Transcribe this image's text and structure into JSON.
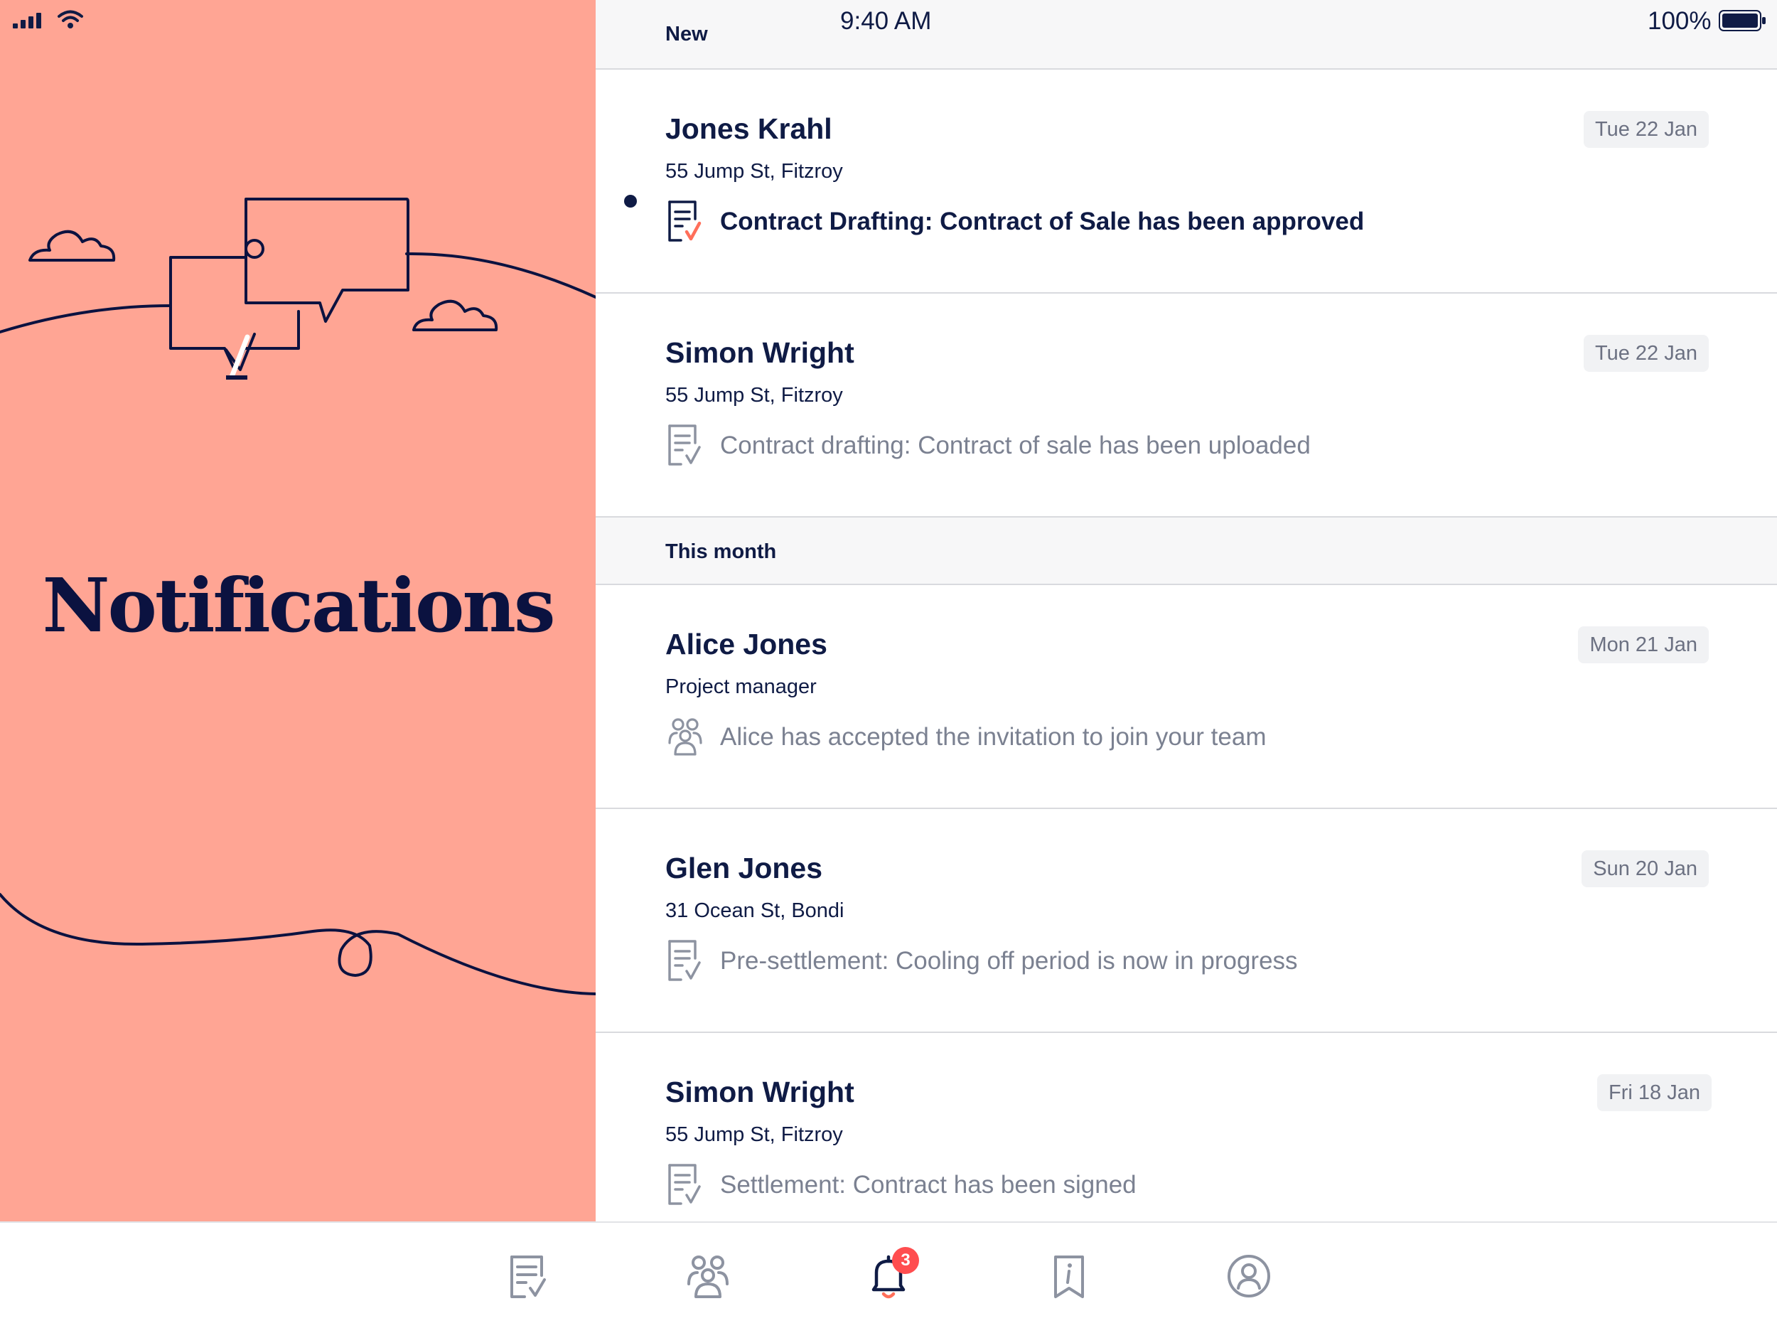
{
  "status_bar": {
    "time": "9:40 AM",
    "battery_percent": "100%",
    "icons": [
      "signal-icon",
      "wifi-icon",
      "battery-icon"
    ]
  },
  "left_panel": {
    "title": "Notifications",
    "background_color": "#ffa594"
  },
  "sections": [
    {
      "label": "New",
      "notifications": [
        {
          "name": "Jones Krahl",
          "subtitle": "55 Jump St, Fitzroy",
          "message": "Contract Drafting: Contract of Sale has been approved",
          "date": "Tue 22 Jan",
          "icon": "contract-approved-icon",
          "unread": true
        },
        {
          "name": "Simon Wright",
          "subtitle": "55 Jump St, Fitzroy",
          "message": "Contract drafting: Contract of sale has been uploaded",
          "date": "Tue 22 Jan",
          "icon": "contract-icon",
          "unread": false
        }
      ]
    },
    {
      "label": "This month",
      "notifications": [
        {
          "name": "Alice Jones",
          "subtitle": "Project manager",
          "message": "Alice has accepted the invitation to join your team",
          "date": "Mon 21 Jan",
          "icon": "team-icon",
          "unread": false
        },
        {
          "name": "Glen Jones",
          "subtitle": "31 Ocean St, Bondi",
          "message": "Pre-settlement: Cooling off period is now in progress",
          "date": "Sun 20 Jan",
          "icon": "contract-icon",
          "unread": false
        },
        {
          "name": "Simon Wright",
          "subtitle": "55 Jump St, Fitzroy",
          "message": "Settlement: Contract has been signed",
          "date": "Fri 18 Jan",
          "icon": "contract-icon",
          "unread": false
        }
      ]
    }
  ],
  "tab_bar": {
    "tabs": [
      {
        "icon": "contracts-tab-icon",
        "active": false
      },
      {
        "icon": "team-tab-icon",
        "active": false
      },
      {
        "icon": "bell-icon",
        "active": true,
        "badge": "3"
      },
      {
        "icon": "info-bookmark-icon",
        "active": false
      },
      {
        "icon": "profile-icon",
        "active": false
      }
    ]
  },
  "colors": {
    "navy": "#0f1b45",
    "salmon": "#ffa594",
    "badge_red": "#ff4d4f",
    "muted_text": "#7b8191"
  }
}
